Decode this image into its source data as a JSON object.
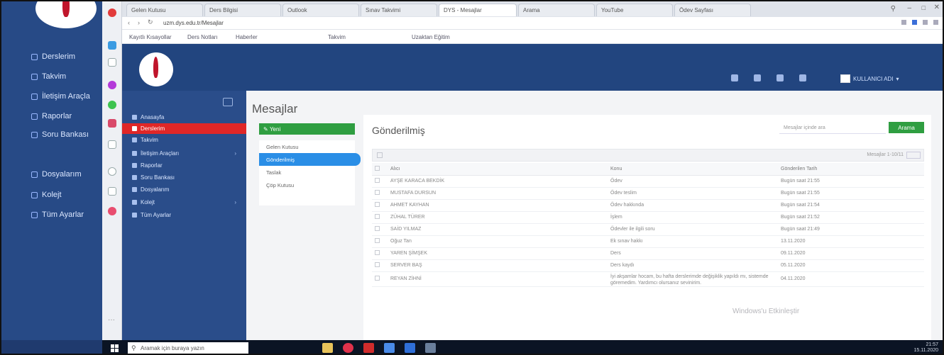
{
  "outer_sidebar": {
    "items": [
      "Derslerim",
      "Takvim",
      "İletişim Araçla",
      "Raporlar",
      "Soru Bankası",
      "Dosyalarım",
      "Kolejt",
      "Tüm Ayarlar"
    ]
  },
  "browser": {
    "tabs": [
      "Gelen Kutusu",
      "Ders Bilgisi",
      "Outlook",
      "Sınav Takvimi",
      "DYS - Mesajlar",
      "Arama",
      "YouTube",
      "Ödev Sayfası"
    ],
    "url": "uzm.dys.edu.tr/Mesajlar",
    "bookmarks": [
      "Kayıtlı Kısayollar",
      "Ders Notları",
      "Haberler",
      "Takvim",
      "Uzaktan Eğitim"
    ]
  },
  "header": {
    "user_name": "KULLANICI ADI"
  },
  "app_sidebar": {
    "items": [
      {
        "label": "Anasayfa",
        "active": false,
        "chevron": false
      },
      {
        "label": "Derslerim",
        "active": true,
        "chevron": false
      },
      {
        "label": "Takvim",
        "active": false,
        "chevron": false
      },
      {
        "label": "İletişim Araçları",
        "active": false,
        "chevron": true
      },
      {
        "label": "Raporlar",
        "active": false,
        "chevron": false
      },
      {
        "label": "Soru Bankası",
        "active": false,
        "chevron": false
      },
      {
        "label": "Dosyalarım",
        "active": false,
        "chevron": false
      },
      {
        "label": "Kolejt",
        "active": false,
        "chevron": true
      },
      {
        "label": "Tüm Ayarlar",
        "active": false,
        "chevron": false
      }
    ]
  },
  "main": {
    "title": "Mesajlar",
    "new_button": "Yeni",
    "folders": [
      {
        "label": "Gelen Kutusu",
        "active": false
      },
      {
        "label": "Gönderilmiş",
        "active": true
      },
      {
        "label": "Taslak",
        "active": false
      },
      {
        "label": "Çöp Kutusu",
        "active": false
      }
    ],
    "card_title": "Gönderilmiş",
    "search_placeholder": "Mesajlar içinde ara",
    "search_button": "Arama",
    "pager": "Mesajlar 1-10/11",
    "columns": [
      "Alıcı",
      "Konu",
      "Gönderilen Tarih"
    ],
    "rows": [
      {
        "to": "AYŞE KARACA BEKDİK",
        "subject": "Ödev",
        "date": "Bugün saat 21:55"
      },
      {
        "to": "MUSTAFA DURSUN",
        "subject": "Ödev teslim",
        "date": "Bugün saat 21:55"
      },
      {
        "to": "AHMET KAYHAN",
        "subject": "Ödev hakkında",
        "date": "Bugün saat 21:54"
      },
      {
        "to": "ZÜHAL TÜRER",
        "subject": "İşlem",
        "date": "Bugün saat 21:52"
      },
      {
        "to": "SAİD YILMAZ",
        "subject": "Ödevler ile ilgili soru",
        "date": "Bugün saat 21:49"
      },
      {
        "to": "Oğuz Tan",
        "subject": "Ek sınav hakkı",
        "date": "13.11.2020"
      },
      {
        "to": "YAREN ŞİMŞEK",
        "subject": "Ders",
        "date": "09.11.2020"
      },
      {
        "to": "SERVER BAŞ",
        "subject": "Ders kaydı",
        "date": "05.11.2020"
      },
      {
        "to": "REYAN ZİHNİ",
        "subject": "İyi akşamlar hocam, bu hafta derslerimde değişiklik yapıldı mı, sistemde göremedim. Yardımcı olursanız sevinirim.",
        "date": "04.11.2020"
      }
    ]
  },
  "watermark": "Windows'u Etkinleştir",
  "taskbar": {
    "search_placeholder": "Aramak için buraya yazın",
    "time": "21:57",
    "date": "15.11.2020"
  },
  "colors": {
    "header_bg": "#22457f",
    "sidebar_bg": "#2a4d8a",
    "active_item": "#e02727",
    "green_button": "#2f9e41",
    "active_folder": "#2a8ee6"
  }
}
